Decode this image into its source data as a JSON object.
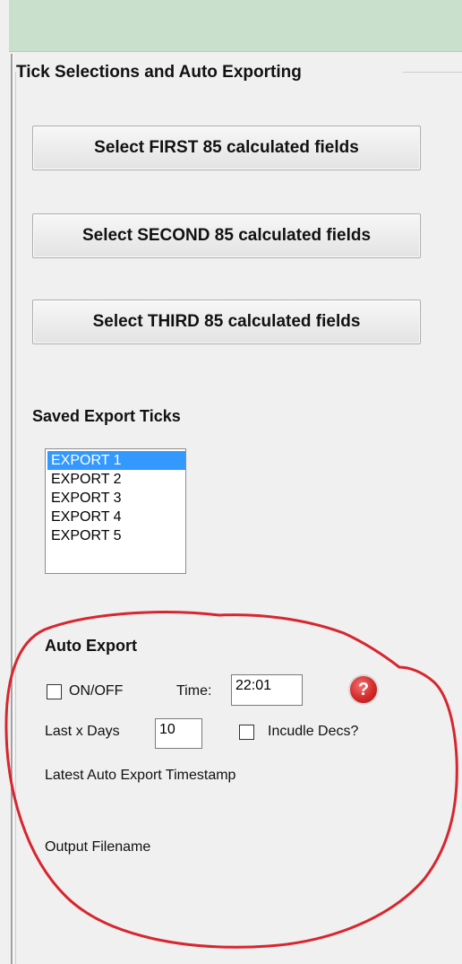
{
  "panel": {
    "title": "Tick Selections and Auto Exporting"
  },
  "buttons": {
    "first": "Select FIRST 85 calculated fields",
    "second": "Select SECOND 85 calculated fields",
    "third": "Select THIRD 85 calculated fields"
  },
  "saved_exports": {
    "title": "Saved Export Ticks",
    "items": [
      "EXPORT 1",
      "EXPORT 2",
      "EXPORT 3",
      "EXPORT 4",
      "EXPORT 5"
    ],
    "selected": "EXPORT 1"
  },
  "auto_export": {
    "title": "Auto Export",
    "onoff_label": "ON/OFF",
    "time_label": "Time:",
    "time_value": "22:01",
    "last_days_label": "Last x Days",
    "last_days_value": "10",
    "include_decs_label": "Incudle Decs?",
    "timestamp_label": "Latest Auto Export Timestamp",
    "filename_label": "Output Filename",
    "help_icon": "question-icon"
  },
  "colors": {
    "selection": "#3399ff",
    "annotation": "#d7262f",
    "help_icon": "#d32b2b"
  }
}
